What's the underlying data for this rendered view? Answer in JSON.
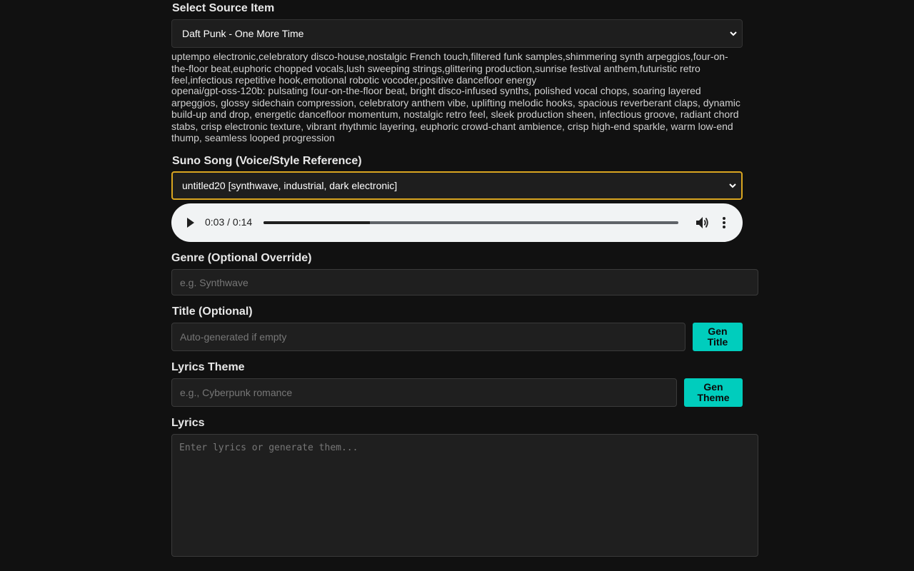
{
  "source_item": {
    "label": "Select Source Item",
    "selected": "Daft Punk - One More Time",
    "tags": "uptempo electronic,celebratory disco-house,nostalgic French touch,filtered funk samples,shimmering synth arpeggios,four-on-the-floor beat,euphoric chopped vocals,lush sweeping strings,glittering production,sunrise festival anthem,futuristic retro feel,infectious repetitive hook,emotional robotic vocoder,positive dancefloor energy",
    "model_description": "openai/gpt-oss-120b: pulsating four-on-the-floor beat, bright disco-infused synths, polished vocal chops, soaring layered arpeggios, glossy sidechain compression, celebratory anthem vibe, uplifting melodic hooks, spacious reverberant claps, dynamic build-up and drop, energetic dancefloor momentum, nostalgic retro feel, sleek production sheen, infectious groove, radiant chord stabs, crisp electronic texture, vibrant rhythmic layering, euphoric crowd-chant ambience, crisp high-end sparkle, warm low-end thump, seamless looped progression"
  },
  "suno_song": {
    "label": "Suno Song (Voice/Style Reference)",
    "selected": "untitled20 [synthwave, industrial, dark electronic]"
  },
  "audio": {
    "time": "0:03 / 0:14",
    "progress_fraction": 0.257,
    "icons": {
      "play": "play-icon",
      "volume": "volume-icon",
      "more": "more-vert-icon"
    }
  },
  "genre": {
    "label": "Genre (Optional Override)",
    "placeholder": "e.g. Synthwave"
  },
  "title": {
    "label": "Title (Optional)",
    "placeholder": "Auto-generated if empty",
    "button": "Gen Title"
  },
  "lyrics_theme": {
    "label": "Lyrics Theme",
    "placeholder": "e.g., Cyberpunk romance",
    "button": "Gen Theme"
  },
  "lyrics": {
    "label": "Lyrics",
    "placeholder": "Enter lyrics or generate them..."
  },
  "colors": {
    "background": "#111111",
    "accent_button": "#00cdbd",
    "focus_border": "#d9a520"
  }
}
